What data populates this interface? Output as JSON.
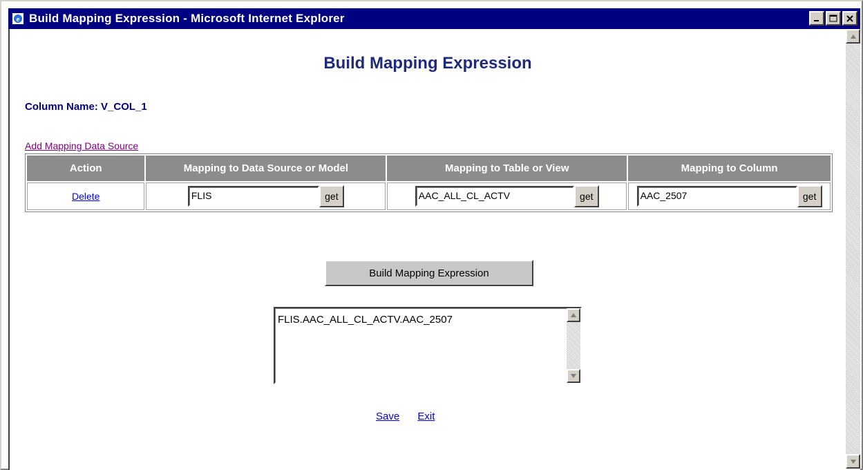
{
  "window": {
    "title": "Build Mapping Expression - Microsoft Internet Explorer"
  },
  "page": {
    "heading": "Build Mapping Expression",
    "column_name": "Column Name: V_COL_1",
    "add_link": "Add Mapping Data Source"
  },
  "table": {
    "headers": [
      "Action",
      "Mapping to Data Source or Model",
      "Mapping to Table or View",
      "Mapping to Column"
    ],
    "row": {
      "action": "Delete",
      "data_source": "FLIS",
      "table_view": "AAC_ALL_CL_ACTV",
      "column": "AAC_2507",
      "get_label": "get"
    }
  },
  "build_button": "Build Mapping Expression",
  "expression": "FLIS.AAC_ALL_CL_ACTV.AAC_2507",
  "links": {
    "save": "Save",
    "exit": "Exit"
  },
  "colors": {
    "titlebar": "#000080",
    "heading": "#1f2a7a",
    "header_cell": "#8c8c8c",
    "link": "#0000ee",
    "visited_link": "#800080"
  },
  "icons": {
    "app": "ie-icon",
    "minimize": "minimize-icon",
    "maximize": "maximize-icon",
    "close": "close-icon"
  }
}
